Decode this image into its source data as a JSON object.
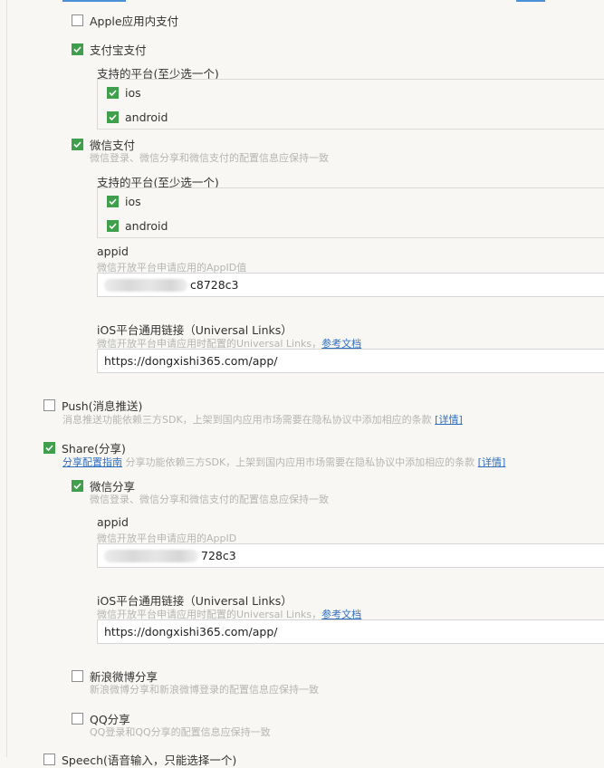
{
  "payment": {
    "apple_iap": {
      "label": "Apple应用内支付",
      "checked": false
    },
    "alipay": {
      "label": "支付宝支付",
      "checked": true,
      "platforms_title": "支持的平台(至少选一个)",
      "platforms": [
        {
          "label": "ios",
          "checked": true
        },
        {
          "label": "android",
          "checked": true
        }
      ]
    },
    "wxpay": {
      "label": "微信支付",
      "checked": true,
      "hint": "微信登录、微信分享和微信支付的配置信息应保持一致",
      "platforms_title": "支持的平台(至少选一个)",
      "platforms": [
        {
          "label": "ios",
          "checked": true
        },
        {
          "label": "android",
          "checked": true
        }
      ],
      "appid_label": "appid",
      "appid_hint": "微信开放平台申请应用的AppID值",
      "appid_value_visible": "c8728c3",
      "ulink_label": "iOS平台通用链接（Universal Links）",
      "ulink_hint": "微信开放平台申请应用时配置的Universal Links，",
      "ulink_doc": "参考文档",
      "ulink_value": "https://dongxishi365.com/app/"
    }
  },
  "push": {
    "label": "Push(消息推送)",
    "checked": false,
    "hint": "消息推送功能依赖三方SDK，上架到国内应用市场需要在隐私协议中添加相应的条款",
    "detail": "[详情]"
  },
  "share": {
    "label": "Share(分享)",
    "checked": true,
    "guide": "分享配置指南",
    "hint": "分享功能依赖三方SDK，上架到国内应用市场需要在隐私协议中添加相应的条款",
    "detail": "[详情]",
    "weixin": {
      "label": "微信分享",
      "checked": true,
      "hint": "微信登录、微信分享和微信支付的配置信息应保持一致",
      "appid_label": "appid",
      "appid_hint": "微信开放平台申请应用的AppID",
      "appid_value_visible": "728c3",
      "ulink_label": "iOS平台通用链接（Universal Links）",
      "ulink_hint": "微信开放平台申请应用时配置的Universal Links，",
      "ulink_doc": "参考文档",
      "ulink_value": "https://dongxishi365.com/app/"
    },
    "sina": {
      "label": "新浪微博分享",
      "checked": false,
      "hint": "新浪微博分享和新浪微博登录的配置信息应保持一致"
    },
    "qq": {
      "label": "QQ分享",
      "checked": false,
      "hint": "QQ登录和QQ分享的配置信息应保持一致"
    }
  },
  "next_section_partial": "Speech(语音输入，只能选择一个)"
}
